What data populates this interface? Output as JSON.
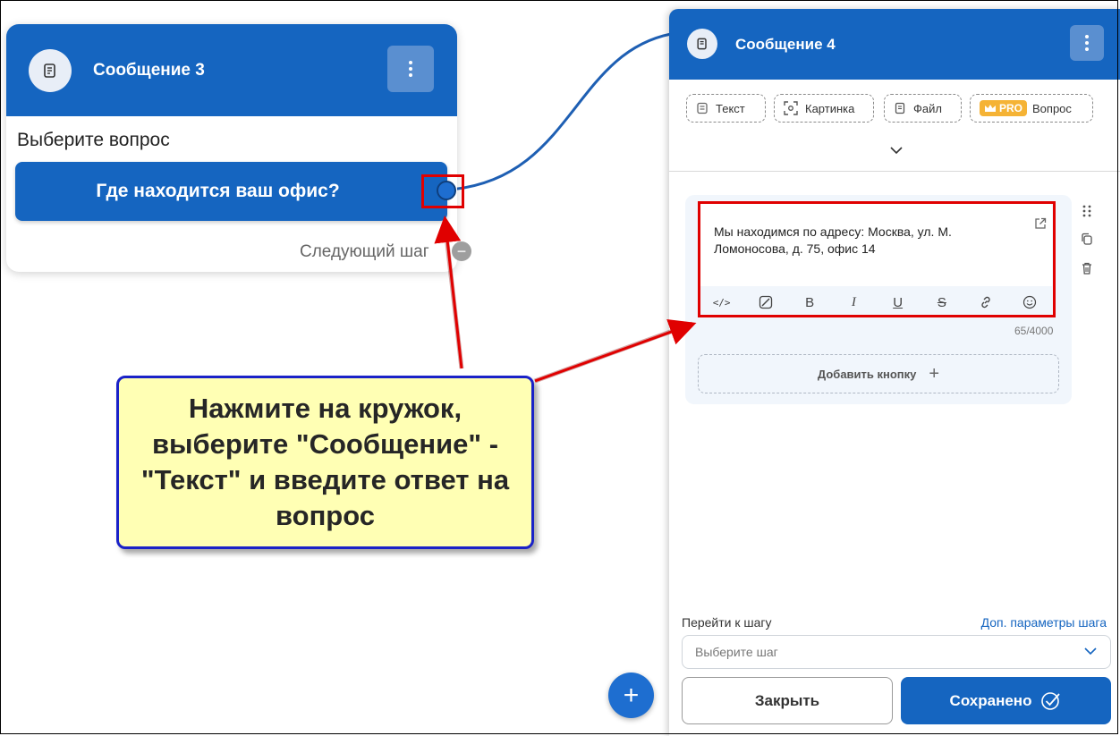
{
  "left_node": {
    "title": "Сообщение 3",
    "question": "Выберите вопрос",
    "answer_button": "Где находится ваш офис?",
    "next_step": "Следующий шаг",
    "next_step_icon": "minus"
  },
  "callout": {
    "text": "Нажмите на кружок, выберите \"Сообщение\" - \"Текст\" и введите ответ на вопрос"
  },
  "panel": {
    "title": "Сообщение 4",
    "types": [
      {
        "label": "Текст",
        "icon": "text-icon"
      },
      {
        "label": "Картинка",
        "icon": "image-icon"
      },
      {
        "label": "Файл",
        "icon": "file-icon"
      },
      {
        "label": "Вопрос",
        "icon": "question-icon",
        "badge": "PRO"
      }
    ],
    "message_text": "Мы находимся по адресу: Москва, ул. М. Ломоносова, д. 75, офис 14",
    "counter": "65/4000",
    "add_button": "Добавить кнопку",
    "goto_label": "Перейти к шагу",
    "goto_link": "Доп. параметры шага",
    "goto_placeholder": "Выберите шаг",
    "close_button": "Закрыть",
    "save_button": "Сохранено"
  },
  "colors": {
    "brand_blue": "#1565c0",
    "highlight_red": "#e00000",
    "callout_bg": "#ffffb4",
    "callout_border": "#1a22c8",
    "pro_badge": "#f5b335"
  }
}
